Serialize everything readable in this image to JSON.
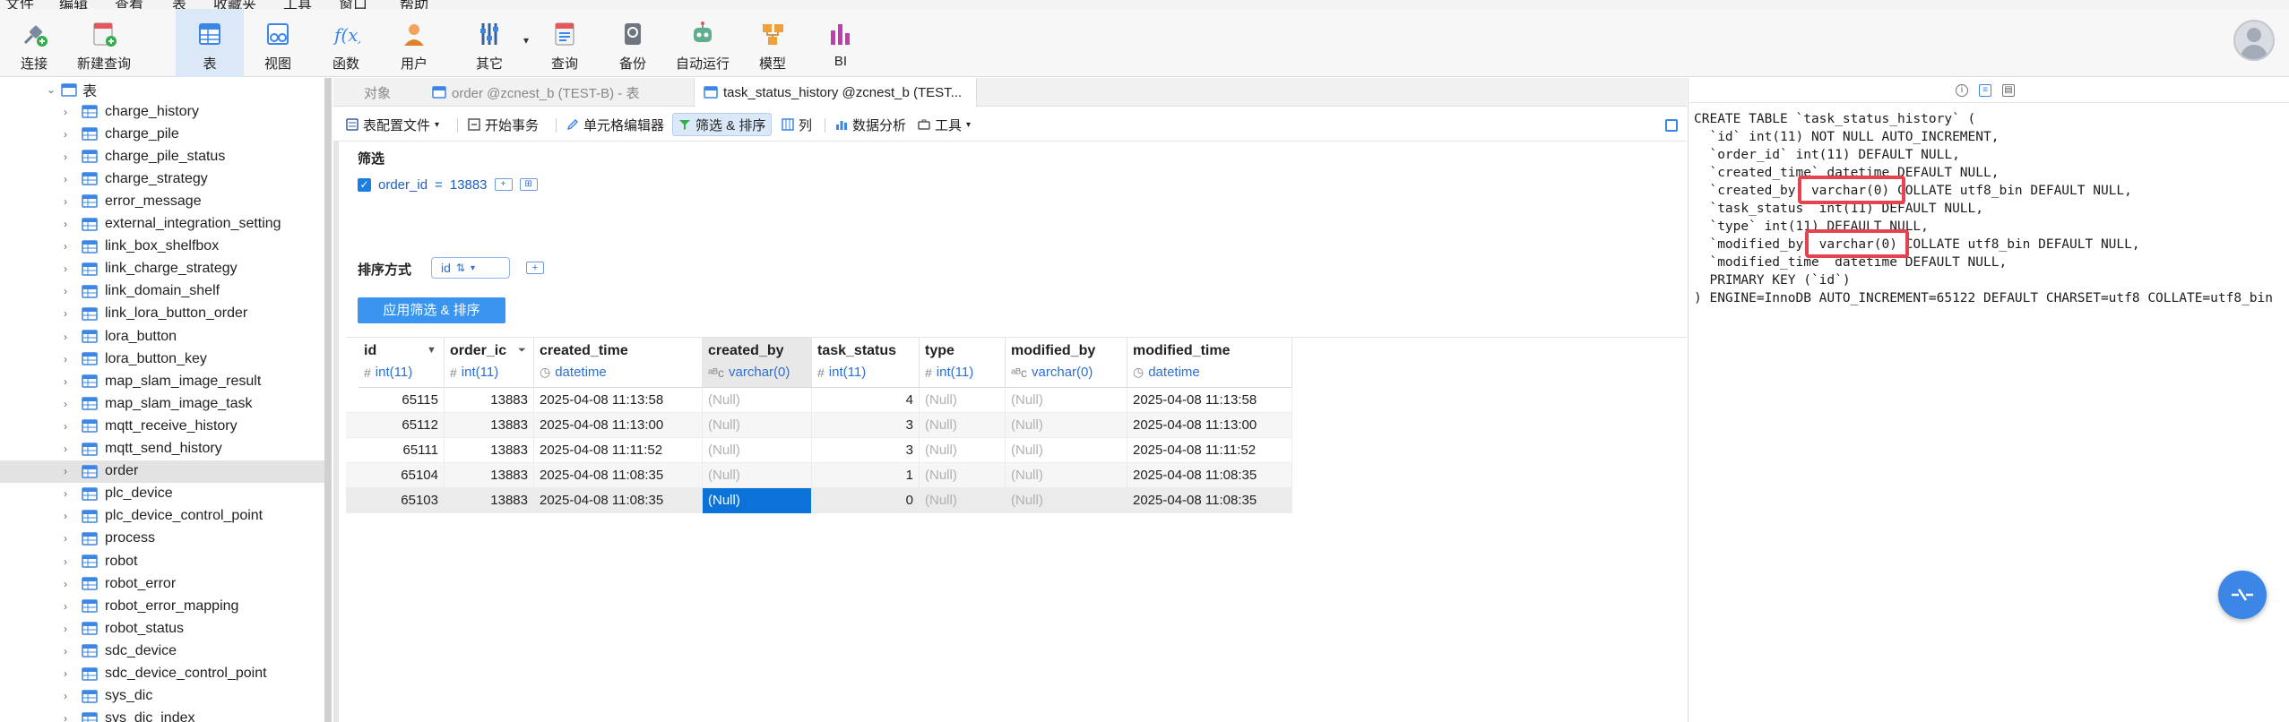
{
  "menu": [
    "文件",
    "编辑",
    "查看",
    "表",
    "收藏夹",
    "工具",
    "窗口",
    "帮助"
  ],
  "toolbar": [
    {
      "label": "连接",
      "icon": "connect-icon"
    },
    {
      "label": "新建查询",
      "icon": "new-query-icon"
    },
    {
      "label": "表",
      "icon": "table-icon",
      "active": true
    },
    {
      "label": "视图",
      "icon": "view-icon"
    },
    {
      "label": "函数",
      "icon": "function-icon"
    },
    {
      "label": "用户",
      "icon": "user-icon"
    },
    {
      "label": "其它",
      "icon": "other-icon"
    },
    {
      "label": "查询",
      "icon": "query-icon"
    },
    {
      "label": "备份",
      "icon": "backup-icon"
    },
    {
      "label": "自动运行",
      "icon": "automation-icon"
    },
    {
      "label": "模型",
      "icon": "model-icon"
    },
    {
      "label": "BI",
      "icon": "bi-icon"
    }
  ],
  "tree": {
    "root_label": "表",
    "items": [
      "charge_history",
      "charge_pile",
      "charge_pile_status",
      "charge_strategy",
      "error_message",
      "external_integration_setting",
      "link_box_shelfbox",
      "link_charge_strategy",
      "link_domain_shelf",
      "link_lora_button_order",
      "lora_button",
      "lora_button_key",
      "map_slam_image_result",
      "map_slam_image_task",
      "mqtt_receive_history",
      "mqtt_send_history",
      "order",
      "plc_device",
      "plc_device_control_point",
      "process",
      "robot",
      "robot_error",
      "robot_error_mapping",
      "robot_status",
      "sdc_device",
      "sdc_device_control_point",
      "sys_dic",
      "sys_dic_index"
    ],
    "selected": "order"
  },
  "tabs": [
    {
      "label": "对象"
    },
    {
      "label": "order @zcnest_b (TEST-B) - 表"
    },
    {
      "label": "task_status_history @zcnest_b (TEST..."
    }
  ],
  "objbar": {
    "table_config": "表配置文件",
    "begin_tx": "开始事务",
    "cell_editor": "单元格编辑器",
    "filter_sort": "筛选 & 排序",
    "columns": "列",
    "data_analysis": "数据分析",
    "tools": "工具"
  },
  "filter": {
    "title": "筛选",
    "field": "order_id",
    "op": "=",
    "value": "13883"
  },
  "sort": {
    "title": "排序方式",
    "field": "id",
    "apply_label": "应用筛选 & 排序"
  },
  "grid": {
    "columns": [
      {
        "name": "id",
        "type": "int(11)",
        "type_icon": "#"
      },
      {
        "name": "order_ic",
        "type": "int(11)",
        "type_icon": "#"
      },
      {
        "name": "created_time",
        "type": "datetime",
        "type_icon": "◷"
      },
      {
        "name": "created_by",
        "type": "varchar(0)",
        "type_icon": "ᵃᴮc"
      },
      {
        "name": "task_status",
        "type": "int(11)",
        "type_icon": "#"
      },
      {
        "name": "type",
        "type": "int(11)",
        "type_icon": "#"
      },
      {
        "name": "modified_by",
        "type": "varchar(0)",
        "type_icon": "ᵃᴮc"
      },
      {
        "name": "modified_time",
        "type": "datetime",
        "type_icon": "◷"
      }
    ],
    "rows": [
      [
        "65115",
        "13883",
        "2025-04-08 11:13:58",
        "(Null)",
        "4",
        "(Null)",
        "(Null)",
        "2025-04-08 11:13:58"
      ],
      [
        "65112",
        "13883",
        "2025-04-08 11:13:00",
        "(Null)",
        "3",
        "(Null)",
        "(Null)",
        "2025-04-08 11:13:00"
      ],
      [
        "65111",
        "13883",
        "2025-04-08 11:11:52",
        "(Null)",
        "3",
        "(Null)",
        "(Null)",
        "2025-04-08 11:11:52"
      ],
      [
        "65104",
        "13883",
        "2025-04-08 11:08:35",
        "(Null)",
        "1",
        "(Null)",
        "(Null)",
        "2025-04-08 11:08:35"
      ],
      [
        "65103",
        "13883",
        "2025-04-08 11:08:35",
        "(Null)",
        "0",
        "(Null)",
        "(Null)",
        "2025-04-08 11:08:35"
      ]
    ]
  },
  "ddl": {
    "l1": "CREATE TABLE `task_status_history` (",
    "l2": "  `id` int(11) NOT NULL AUTO_INCREMENT,",
    "l3": "  `order_id` int(11) DEFAULT NULL,",
    "l4": "  `created_time` datetime DEFAULT NULL,",
    "l5": "  `created_by` varchar(0) COLLATE utf8_bin DEFAULT NULL,",
    "l6": "  `task_status` int(11) DEFAULT NULL,",
    "l7": "  `type` int(11) DEFAULT NULL,",
    "l8": "  `modified_by` varchar(0) COLLATE utf8_bin DEFAULT NULL,",
    "l9": "  `modified_time` datetime DEFAULT NULL,",
    "l10": "  PRIMARY KEY (`id`)",
    "l11": ") ENGINE=InnoDB AUTO_INCREMENT=65122 DEFAULT CHARSET=utf8 COLLATE=utf8_bin"
  },
  "colors": {
    "accent": "#3a95f0",
    "selected_cell": "#0a72d9",
    "highlight_box": "#e5434f"
  }
}
